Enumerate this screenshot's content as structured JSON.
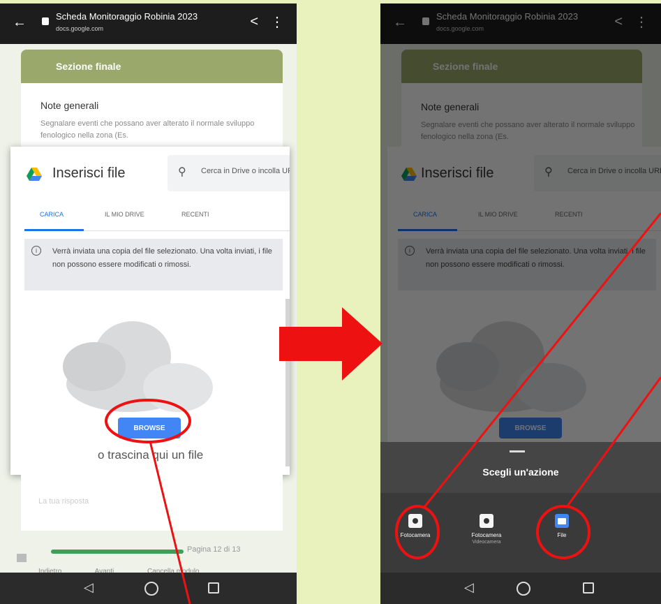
{
  "browser": {
    "page_title": "Scheda Monitoraggio Robinia 2023",
    "domain": "docs.google.com"
  },
  "form": {
    "section_title": "Sezione finale",
    "question_title": "Note generali",
    "question_desc": "Segnalare eventi che possano aver alterato il normale sviluppo fenologico nella zona (Es.",
    "answer_placeholder": "La tua risposta",
    "page_indicator": "Pagina 12 di 13",
    "back_label": "Indietro",
    "next_label": "Avanti",
    "clear_label": "Cancella modulo",
    "progress": 0.92
  },
  "dialog": {
    "title": "Inserisci file",
    "search_placeholder": "Cerca in Drive o incolla URL",
    "tabs": [
      "CARICA",
      "IL MIO DRIVE",
      "RECENTI"
    ],
    "info": "Verrà inviata una copia del file selezionato. Una volta inviati, i file non possono essere modificati o rimossi.",
    "browse_label": "BROWSE",
    "drag_text": "o trascina qui un file"
  },
  "action_sheet": {
    "title": "Scegli un'azione",
    "actions": [
      {
        "label": "Fotocamera",
        "sub": ""
      },
      {
        "label": "Fotocamera",
        "sub": "Videocamera"
      },
      {
        "label": "File",
        "sub": ""
      }
    ]
  },
  "colors": {
    "background": "#e9f2bd",
    "section_header": "#9aa86b",
    "accent": "#1a73e8",
    "browse_button": "#4285f4",
    "annotation": "#ee1111"
  },
  "icons": [
    "back-arrow-icon",
    "lock-icon",
    "share-icon",
    "more-vert-icon",
    "google-drive-icon",
    "search-icon",
    "info-icon",
    "cloud-icon",
    "camera-icon",
    "folder-icon",
    "nav-back-icon",
    "nav-home-icon",
    "nav-recents-icon"
  ]
}
